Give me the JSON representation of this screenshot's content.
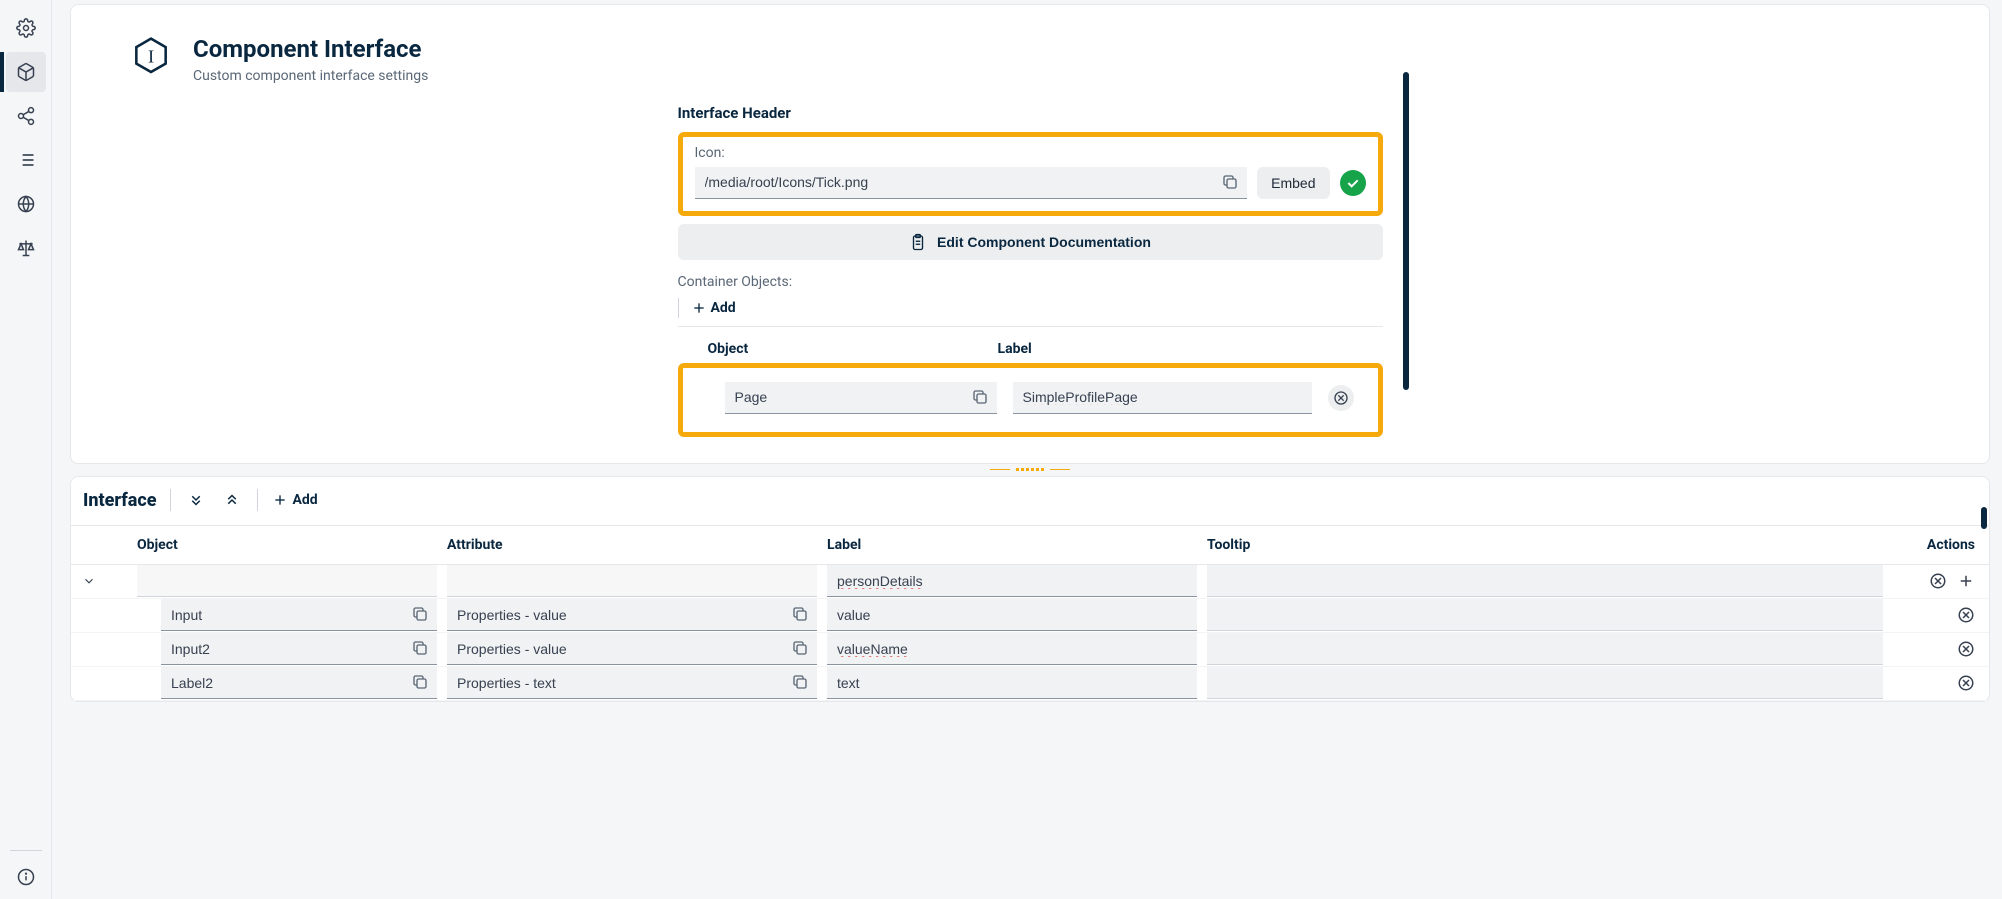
{
  "header": {
    "title": "Component Interface",
    "subtitle": "Custom component interface settings"
  },
  "form": {
    "section_title": "Interface Header",
    "icon_label": "Icon:",
    "icon_value": "/media/root/Icons/Tick.png",
    "embed_label": "Embed",
    "doc_button": "Edit Component Documentation",
    "container_label": "Container Objects:",
    "add_label": "Add",
    "col_object": "Object",
    "col_label": "Label",
    "row": {
      "object": "Page",
      "label": "SimpleProfilePage"
    }
  },
  "iface": {
    "title": "Interface",
    "add_label": "Add",
    "cols": {
      "object": "Object",
      "attribute": "Attribute",
      "label": "Label",
      "tooltip": "Tooltip",
      "actions": "Actions"
    },
    "rows": [
      {
        "object": "",
        "attribute": "",
        "label": "personDetails",
        "tooltip": "",
        "group": true
      },
      {
        "object": "Input",
        "attribute": "Properties - value",
        "label": "value",
        "tooltip": ""
      },
      {
        "object": "Input2",
        "attribute": "Properties - value",
        "label": "valueName",
        "tooltip": ""
      },
      {
        "object": "Label2",
        "attribute": "Properties - text",
        "label": "text",
        "tooltip": ""
      }
    ]
  }
}
